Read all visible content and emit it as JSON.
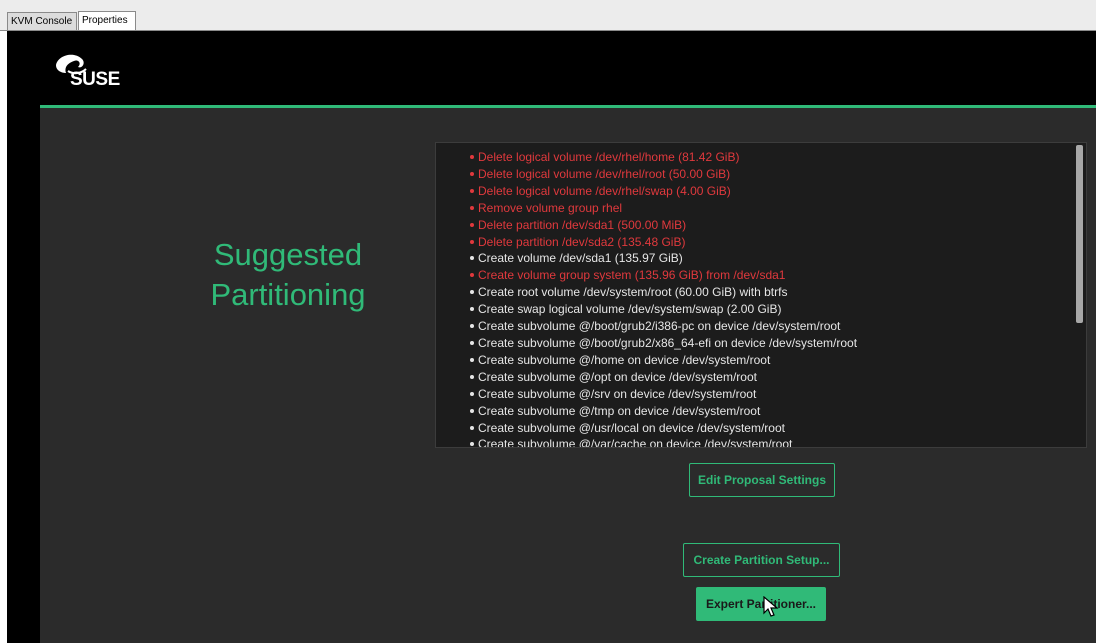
{
  "tabs": [
    {
      "label": "KVM Console",
      "selected": false
    },
    {
      "label": "Properties",
      "selected": true
    }
  ],
  "header": {
    "logo_text": "SUSE",
    "logo_icon": "suse-chameleon-icon"
  },
  "page": {
    "title_line1": "Suggested",
    "title_line2": "Partitioning"
  },
  "proposal_actions": [
    {
      "text": "Delete logical volume /dev/rhel/home (81.42 GiB)",
      "destructive": true
    },
    {
      "text": "Delete logical volume /dev/rhel/root (50.00 GiB)",
      "destructive": true
    },
    {
      "text": "Delete logical volume /dev/rhel/swap (4.00 GiB)",
      "destructive": true
    },
    {
      "text": "Remove volume group rhel",
      "destructive": true
    },
    {
      "text": "Delete partition /dev/sda1 (500.00 MiB)",
      "destructive": true
    },
    {
      "text": "Delete partition /dev/sda2 (135.48 GiB)",
      "destructive": true
    },
    {
      "text": "Create volume /dev/sda1 (135.97 GiB)",
      "destructive": false
    },
    {
      "text": "Create volume group system (135.96 GiB) from /dev/sda1",
      "destructive": true
    },
    {
      "text": "Create root volume /dev/system/root (60.00 GiB) with btrfs",
      "destructive": false
    },
    {
      "text": "Create swap logical volume /dev/system/swap (2.00 GiB)",
      "destructive": false
    },
    {
      "text": "Create subvolume @/boot/grub2/i386-pc on device /dev/system/root",
      "destructive": false
    },
    {
      "text": "Create subvolume @/boot/grub2/x86_64-efi on device /dev/system/root",
      "destructive": false
    },
    {
      "text": "Create subvolume @/home on device /dev/system/root",
      "destructive": false
    },
    {
      "text": "Create subvolume @/opt on device /dev/system/root",
      "destructive": false
    },
    {
      "text": "Create subvolume @/srv on device /dev/system/root",
      "destructive": false
    },
    {
      "text": "Create subvolume @/tmp on device /dev/system/root",
      "destructive": false
    },
    {
      "text": "Create subvolume @/usr/local on device /dev/system/root",
      "destructive": false
    },
    {
      "text": "Create subvolume @/var/cache on device /dev/system/root",
      "destructive": false
    }
  ],
  "buttons": {
    "edit_proposal": "Edit Proposal Settings",
    "create_partition": "Create Partition Setup...",
    "expert_partitioner": "Expert Partitioner..."
  },
  "colors": {
    "accent_green": "#30ba78",
    "destructive_red": "#e0393d",
    "background": "#2b2b2b"
  }
}
